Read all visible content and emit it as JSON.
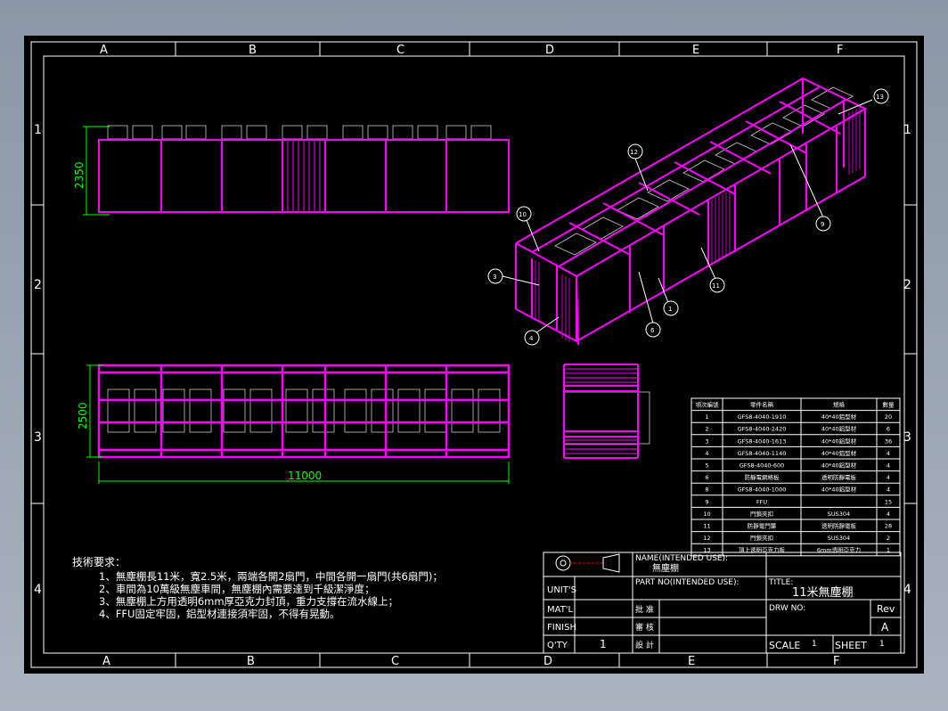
{
  "colors": {
    "background": "#000000",
    "frame": "#ffffff",
    "part": "#ff00ff",
    "dimension": "#00ff00",
    "window": "#8e99a8"
  },
  "zones": {
    "columns": [
      "A",
      "B",
      "C",
      "D",
      "E",
      "F"
    ],
    "rows": [
      "1",
      "2",
      "3",
      "4"
    ]
  },
  "dimensions": {
    "height": "2350",
    "width": "2500",
    "length": "11000"
  },
  "balloons": [
    "13",
    "12",
    "10",
    "9",
    "3",
    "11",
    "1",
    "6",
    "4"
  ],
  "notes": {
    "heading": "技術要求：",
    "items": [
      "1、無塵棚長11米，寬2.5米，兩端各開2扇門，中間各開一扇門(共6扇門)；",
      "2、車間為10萬級無塵車間，無塵棚內需要達到千級潔淨度；",
      "3、無塵棚上方用透明6mm厚亞克力封頂，重力支撐在流水線上；",
      "4、FFU固定牢固，鋁型材連接須牢固，不得有晃動。"
    ]
  },
  "bom": {
    "headers": [
      "項次編號",
      "零件名稱",
      "規格",
      "數量"
    ],
    "rows": [
      [
        "1",
        "GFS8-4040-1910",
        "40*40鋁型材",
        "20"
      ],
      [
        "2",
        "GFS8-4040-2420",
        "40*40鋁型材",
        "6"
      ],
      [
        "3",
        "GFS8-4040-1613",
        "40*40鋁型材",
        "36"
      ],
      [
        "4",
        "GFS8-4040-1140",
        "40*40鋁型材",
        "4"
      ],
      [
        "5",
        "GFS8-4040-600",
        "40*40鋁型材",
        "4"
      ],
      [
        "6",
        "防靜電網格板",
        "透明防靜電板",
        "4"
      ],
      [
        "8",
        "GFS8-4040-1000",
        "40*40鋁型材",
        "4"
      ],
      [
        "9",
        "FFU",
        "",
        "15"
      ],
      [
        "10",
        "門鎖夾扣",
        "SUS304",
        "4"
      ],
      [
        "11",
        "防靜電門簾",
        "透明防靜電板",
        "28"
      ],
      [
        "12",
        "門鎖夾扣",
        "SUS304",
        "2"
      ],
      [
        "13",
        "頂上透明亞克力板",
        "6mm透明亞克力",
        "1"
      ]
    ]
  },
  "title_block": {
    "name_label": "NAME(INTENDED USE):",
    "name_value": "無塵棚",
    "part_label": "PART NO(INTENDED USE):",
    "title_label": "TITLE:",
    "title_value": "11米無塵棚",
    "units_label": "UNIT'S",
    "matl_label": "MAT'L",
    "finish_label": "FINISH",
    "qty_label": "Q'TY",
    "qty_value": "1",
    "approve_label": "批 准",
    "review_label": "審 核",
    "design_label": "設 計",
    "drw_label": "DRW NO:",
    "rev_label": "Rev",
    "rev_value": "A",
    "scale_label": "SCALE",
    "scale_value": "1",
    "sheet_label": "SHEET",
    "sheet_value": "1"
  }
}
